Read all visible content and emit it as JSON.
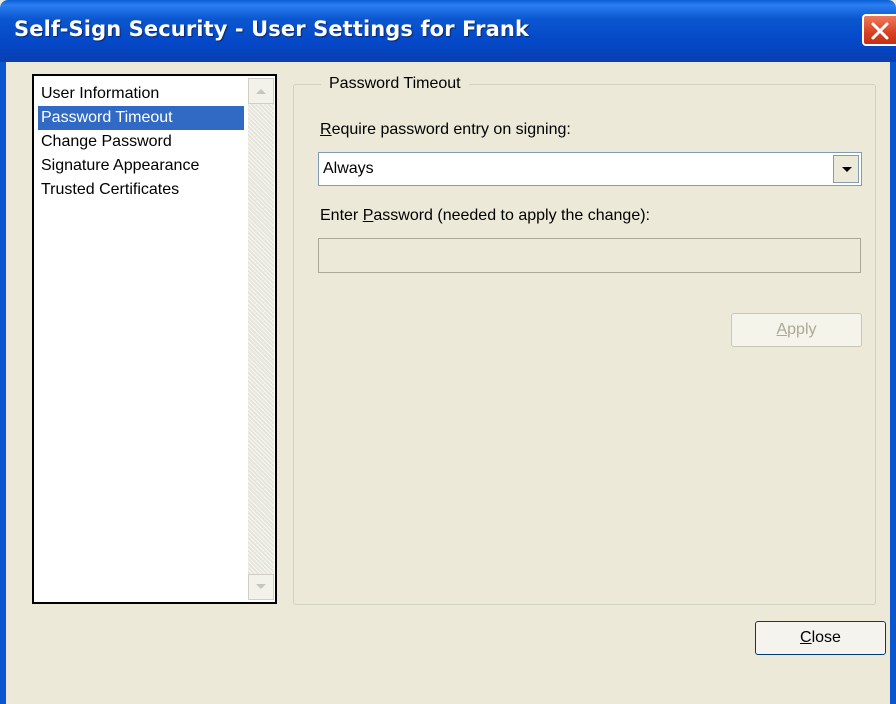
{
  "window": {
    "title": "Self-Sign Security - User Settings for Frank"
  },
  "sidebar": {
    "items": [
      {
        "label": "User Information",
        "selected": false
      },
      {
        "label": "Password Timeout",
        "selected": true
      },
      {
        "label": "Change Password",
        "selected": false
      },
      {
        "label": "Signature Appearance",
        "selected": false
      },
      {
        "label": "Trusted Certificates",
        "selected": false
      }
    ]
  },
  "panel": {
    "group_title": "Password Timeout",
    "require_label": {
      "mnemonic": "R",
      "rest": "equire password entry on signing:"
    },
    "require_value": "Always",
    "password_label": {
      "before": "Enter ",
      "mnemonic": "P",
      "rest": "assword (needed to apply the change):"
    },
    "password_value": "",
    "apply_button": {
      "mnemonic": "A",
      "rest": "pply",
      "enabled": false
    }
  },
  "footer": {
    "close_button": {
      "mnemonic": "C",
      "rest": "lose"
    }
  },
  "colors": {
    "titlebar": "#0b57d0",
    "selection": "#316ac5",
    "dialog_bg": "#ece9d8"
  }
}
